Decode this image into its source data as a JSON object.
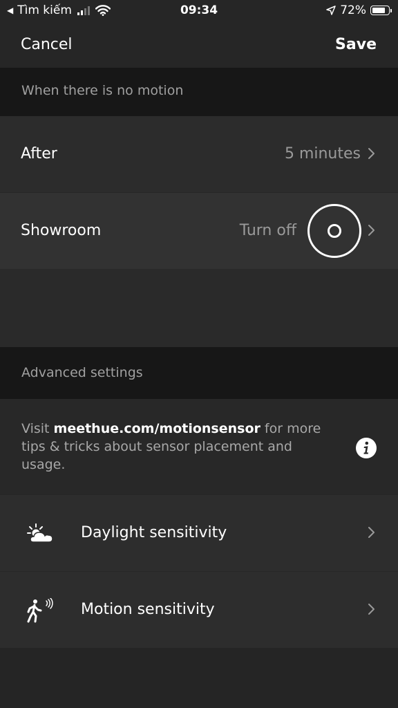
{
  "status_bar": {
    "back_arrow": "◀",
    "carrier": "Tìm kiếm",
    "time": "09:34",
    "battery": "72%",
    "battery_level": 0.72,
    "icons": [
      "signal-icon",
      "wifi-icon",
      "location-arrow-icon",
      "battery-icon"
    ]
  },
  "nav": {
    "cancel_label": "Cancel",
    "save_label": "Save"
  },
  "no_motion_section": {
    "header": "When there is no motion",
    "rows": [
      {
        "label": "After",
        "value": "5 minutes"
      },
      {
        "label": "Showroom",
        "value": "Turn off"
      }
    ]
  },
  "advanced_section": {
    "header": "Advanced settings",
    "info": {
      "prefix": "Visit ",
      "link": "meethue.com/motionsensor",
      "suffix": " for more tips & tricks about sensor placement and usage.",
      "icon": "info-icon"
    },
    "items": [
      {
        "label": "Daylight sensitivity",
        "icon": "daylight-cloud-icon"
      },
      {
        "label": "Motion sensitivity",
        "icon": "walking-person-motion-icon"
      }
    ]
  },
  "colors": {
    "background": "#272727",
    "section_header_bg": "#171717",
    "row_bg": "#2c2c2c",
    "secondary_text": "#9a9a9a",
    "primary_text": "#ffffff"
  }
}
